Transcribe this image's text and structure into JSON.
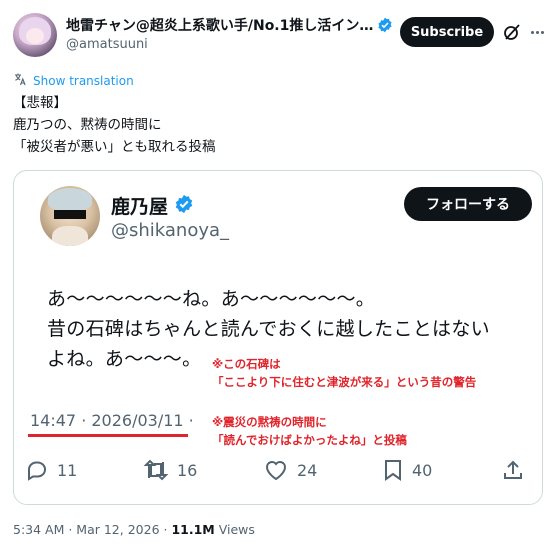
{
  "header": {
    "display_name": "地雷チャン@超炎上系歌い手/No.1推し活イン…",
    "handle": "@amatsuuni",
    "subscribe_label": "Subscribe"
  },
  "translate": {
    "label": "Show translation"
  },
  "post": {
    "lines": [
      "【悲報】",
      "鹿乃つの、黙祷の時間に",
      "「被災者が悪い」とも取れる投稿"
    ]
  },
  "quoted": {
    "name": "鹿乃屋",
    "handle": "@shikanoya_",
    "follow_label": "フォローする",
    "body_lines": [
      "あ〜〜〜〜〜〜ね。あ〜〜〜〜〜〜。",
      "昔の石碑はちゃんと読んでおくに越したことはない",
      "よね。あ〜〜〜。"
    ],
    "timestamp": "14:47 · 2026/03/11 ·",
    "annotation1": [
      "※この石碑は",
      "「ここより下に住むと津波が来る」という昔の警告"
    ],
    "annotation2": [
      "※震災の黙祷の時間に",
      "「読んでおけばよかったよね」と投稿"
    ],
    "actions": {
      "replies": "11",
      "reposts": "16",
      "likes": "24",
      "bookmarks": "40"
    }
  },
  "footer": {
    "time": "5:34 AM · Mar 12, 2026 · ",
    "views_count": "11.1M",
    "views_label": " Views"
  },
  "colors": {
    "accent": "#1d9bf0",
    "annotation": "#e0242b",
    "text_secondary": "#536471"
  }
}
